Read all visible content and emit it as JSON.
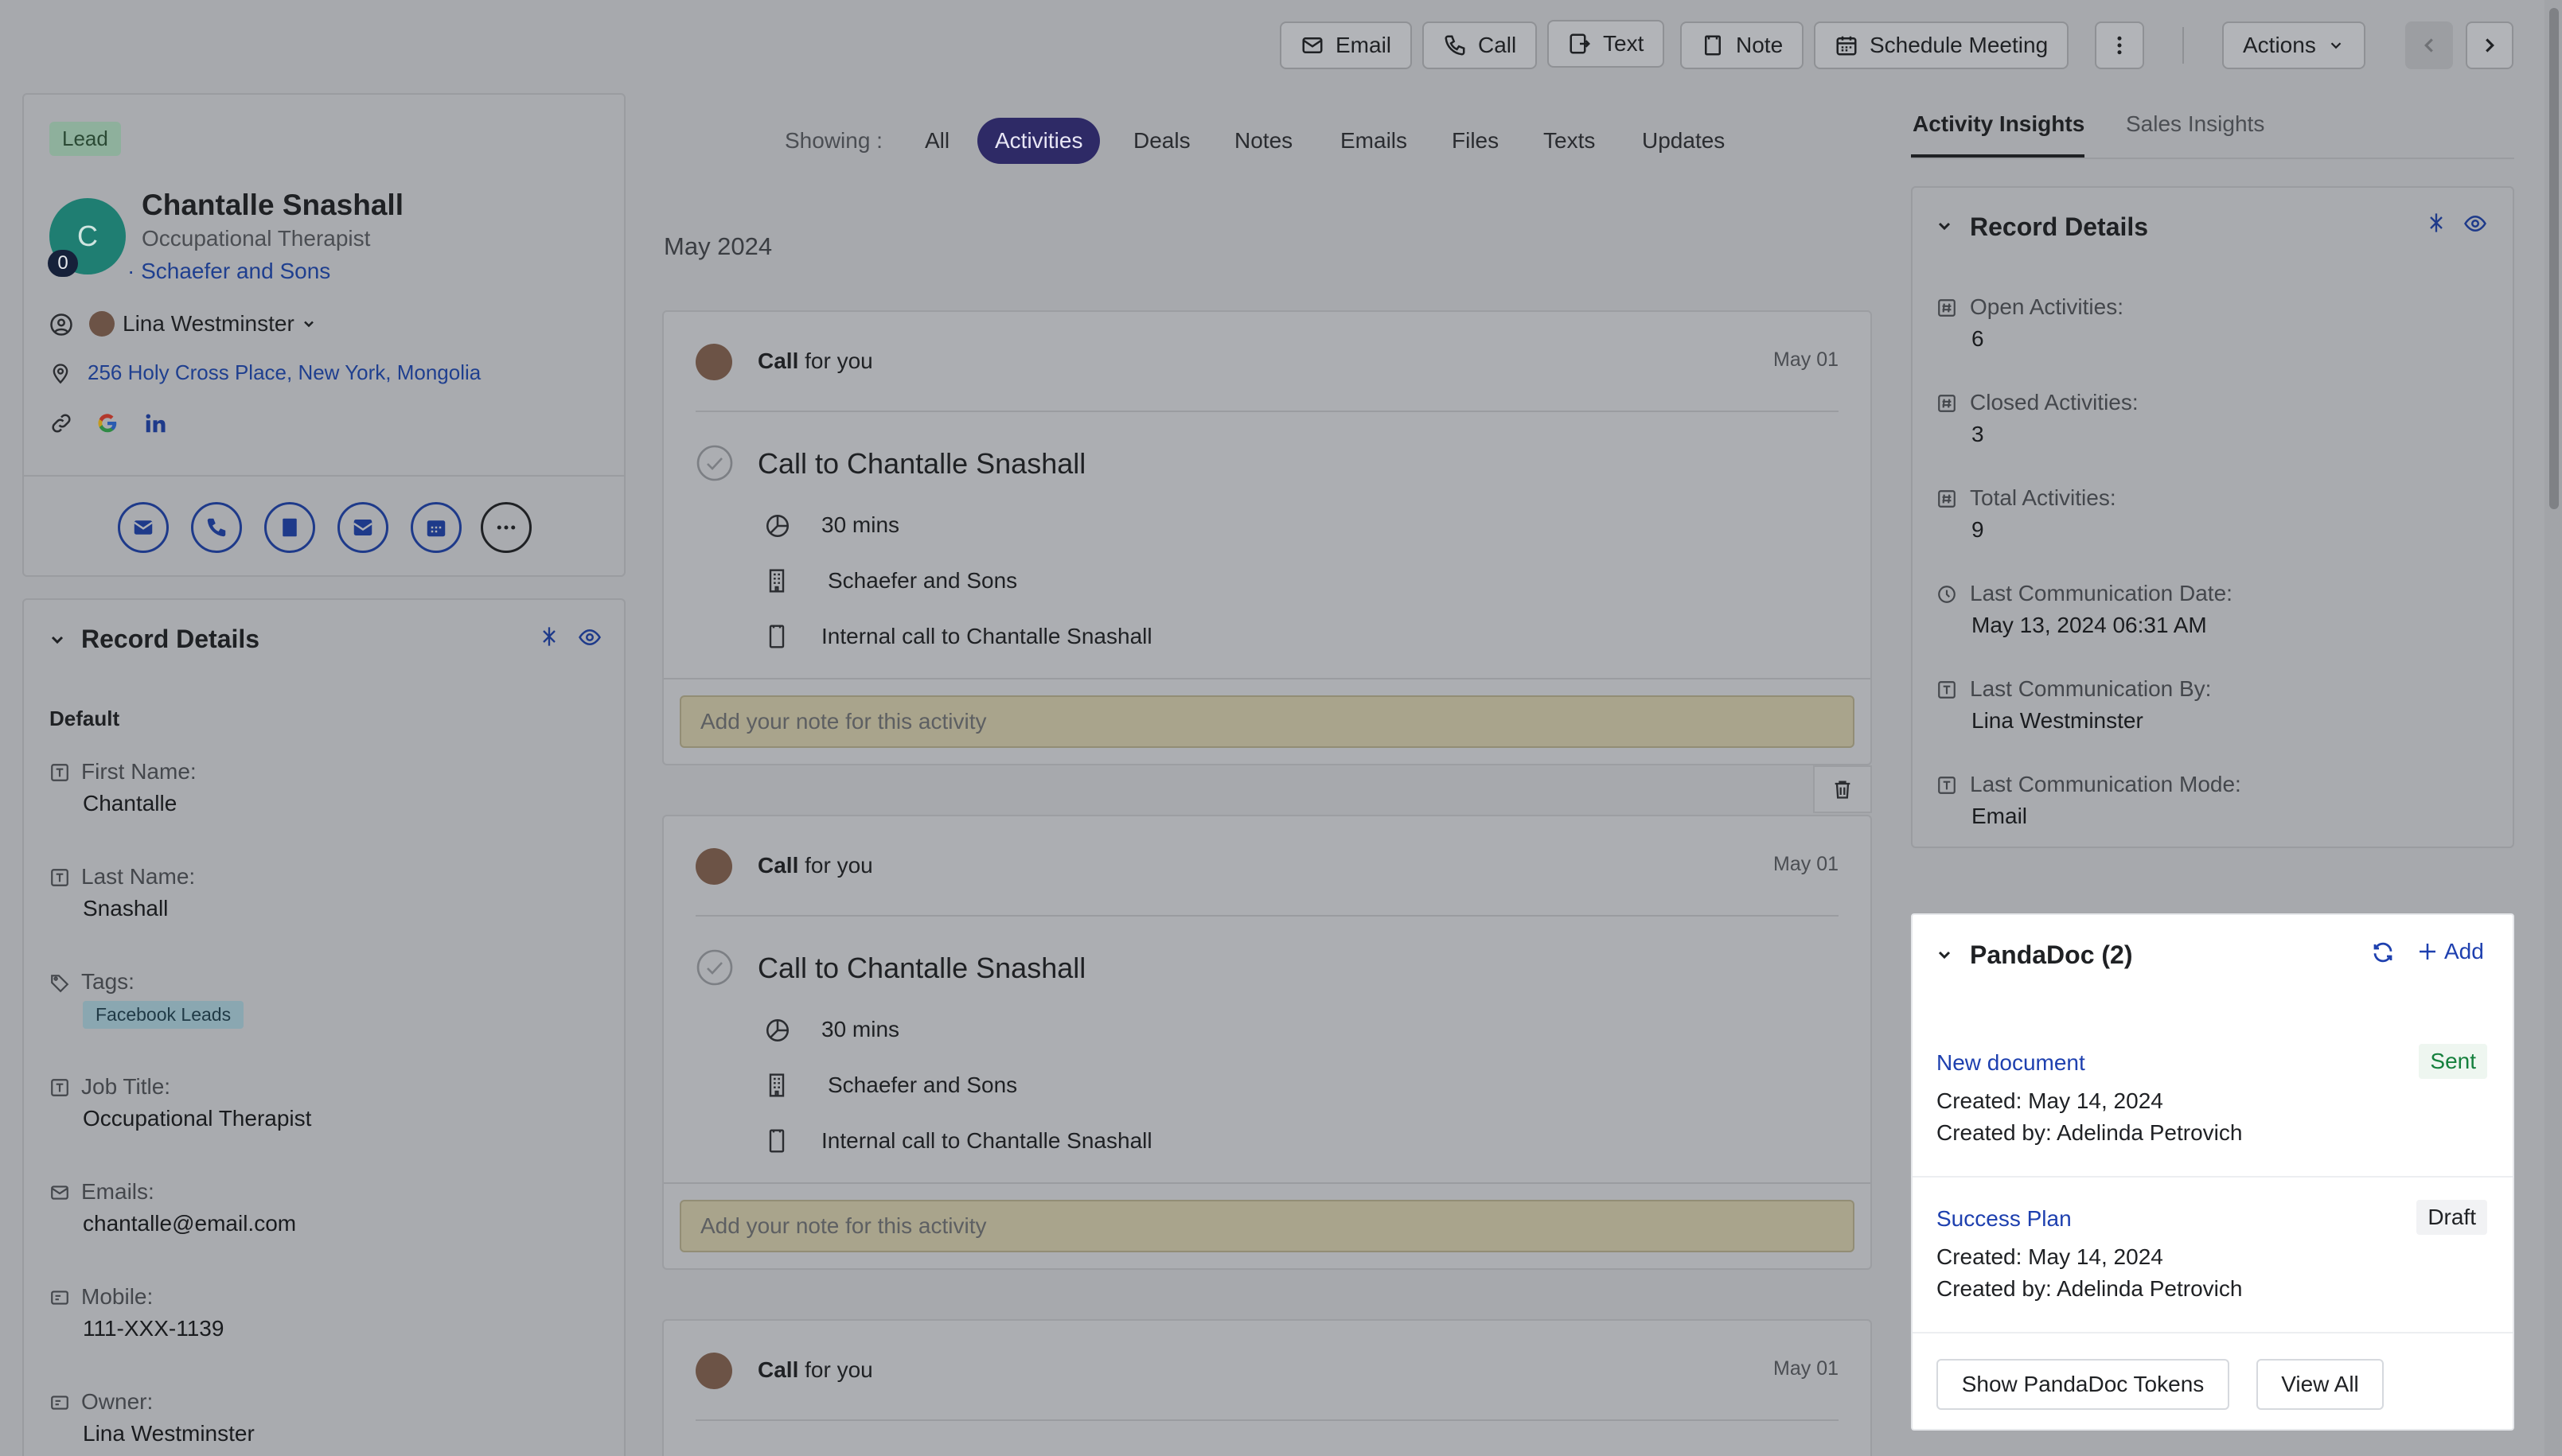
{
  "toolbar": {
    "email": "Email",
    "call": "Call",
    "text": "Text",
    "note": "Note",
    "schedule": "Schedule Meeting",
    "actions": "Actions"
  },
  "contact": {
    "badge": "Lead",
    "avatar_letter": "C",
    "avatar_count": "0",
    "name": "Chantalle Snashall",
    "title": "Occupational Therapist",
    "company": "· Schaefer and Sons",
    "owner": "Lina Westminster",
    "address": "256 Holy Cross Place, New York, Mongolia"
  },
  "left_record": {
    "heading": "Record Details",
    "section": "Default",
    "fields": [
      {
        "label": "First Name:",
        "value": "Chantalle"
      },
      {
        "label": "Last Name:",
        "value": "Snashall"
      },
      {
        "label": "Tags:",
        "value": "Facebook Leads"
      },
      {
        "label": "Job Title:",
        "value": "Occupational Therapist"
      },
      {
        "label": "Emails:",
        "value": "chantalle@email.com"
      },
      {
        "label": "Mobile:",
        "value": "111-XXX-1139"
      },
      {
        "label": "Owner:",
        "value": "Lina Westminster"
      }
    ]
  },
  "filters": {
    "showing": "Showing :",
    "items": [
      "All",
      "Activities",
      "Deals",
      "Notes",
      "Emails",
      "Files",
      "Texts",
      "Updates"
    ]
  },
  "timeline": {
    "month": "May 2024",
    "activities": [
      {
        "header_bold": "Call",
        "header_rest": " for you",
        "date": "May 01",
        "title": "Call to Chantalle Snashall",
        "duration": "30 mins",
        "company": "Schaefer and Sons",
        "description": "Internal call to Chantalle Snashall",
        "note_placeholder": "Add your note for this activity"
      },
      {
        "header_bold": "Call",
        "header_rest": " for you",
        "date": "May 01",
        "title": "Call to Chantalle Snashall",
        "duration": "30 mins",
        "company": "Schaefer and Sons",
        "description": "Internal call to Chantalle Snashall",
        "note_placeholder": "Add your note for this activity"
      },
      {
        "header_bold": "Call",
        "header_rest": " for you",
        "date": "May 01"
      }
    ]
  },
  "insights": {
    "tabs": [
      "Activity Insights",
      "Sales Insights"
    ],
    "heading": "Record Details",
    "fields": [
      {
        "label": "Open Activities:",
        "value": "6"
      },
      {
        "label": "Closed Activities:",
        "value": "3"
      },
      {
        "label": "Total Activities:",
        "value": "9"
      },
      {
        "label": "Last Communication Date:",
        "value": "May 13, 2024 06:31 AM"
      },
      {
        "label": "Last Communication By:",
        "value": "Lina Westminster"
      },
      {
        "label": "Last Communication Mode:",
        "value": "Email"
      }
    ]
  },
  "pandadoc": {
    "heading": "PandaDoc (2)",
    "add": "Add",
    "docs": [
      {
        "name": "New document",
        "status": "Sent",
        "created": "Created: May 14, 2024",
        "created_by": "Created by: Adelinda Petrovich"
      },
      {
        "name": "Success Plan",
        "status": "Draft",
        "created": "Created: May 14, 2024",
        "created_by": "Created by: Adelinda Petrovich"
      }
    ],
    "tokens_button": "Show PandaDoc Tokens",
    "view_all": "View All"
  },
  "colors": {
    "accent": "#2e2a66",
    "link": "#1e40af",
    "sent": "#15803d",
    "lead": "#8eb09c"
  }
}
